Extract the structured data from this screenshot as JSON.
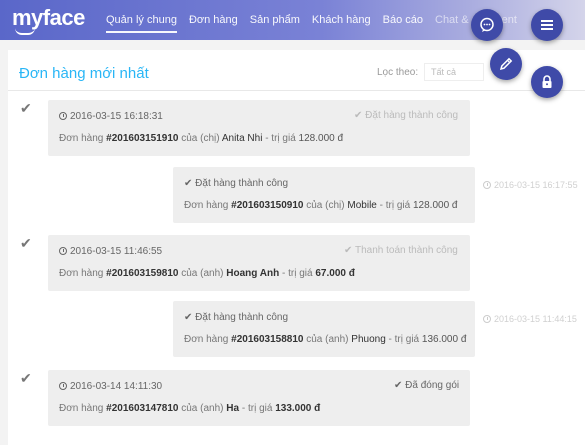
{
  "app": {
    "logo": "myface"
  },
  "nav": {
    "items": [
      "Quản lý chung",
      "Đơn hàng",
      "Sản phẩm",
      "Khách hàng",
      "Báo cáo",
      "Chat & comment"
    ]
  },
  "panel": {
    "title": "Đơn hàng mới nhất",
    "filter_label": "Lọc theo:",
    "filter_value": "Tất cả"
  },
  "orders": [
    {
      "time": "2016-03-15 16:18:31",
      "status": "Đặt hàng thành công",
      "prefix": "Đơn hàng",
      "code": "#201603151910",
      "rel": "của (chị)",
      "name": "Anita Nhi",
      "price_label": "- trị giá",
      "price": "128.000 đ"
    },
    {
      "time": "2016-03-15 16:17:55",
      "status": "Đặt hàng thành công",
      "prefix": "Đơn hàng",
      "code": "#201603150910",
      "rel": "của (chị)",
      "name": "Mobile",
      "price_label": "- trị giá",
      "price": "128.000 đ"
    },
    {
      "time": "2016-03-15 11:46:55",
      "status": "Thanh toán thành công",
      "prefix": "Đơn hàng",
      "code": "#201603159810",
      "rel": "của (anh)",
      "name": "Hoang Anh",
      "price_label": "- trị giá",
      "price": "67.000 đ"
    },
    {
      "time": "2016-03-15 11:44:15",
      "status": "Đặt hàng thành công",
      "prefix": "Đơn hàng",
      "code": "#201603158810",
      "rel": "của (anh)",
      "name": "Phuong",
      "price_label": "- trị giá",
      "price": "136.000 đ"
    },
    {
      "time": "2016-03-14 14:11:30",
      "status": "Đã đóng gói",
      "prefix": "Đơn hàng",
      "code": "#201603147810",
      "rel": "của (anh)",
      "name": "Ha",
      "price_label": "- trị giá",
      "price": "133.000 đ"
    }
  ],
  "icons": {
    "check": "check-icon",
    "clock": "clock-icon",
    "chat": "chat-icon",
    "menu": "menu-icon",
    "edit": "pencil-icon",
    "lock": "lock-icon"
  },
  "colors": {
    "accent": "#29b6f6",
    "fab": "#3f4aa8",
    "nav_start": "#5a67c9"
  }
}
